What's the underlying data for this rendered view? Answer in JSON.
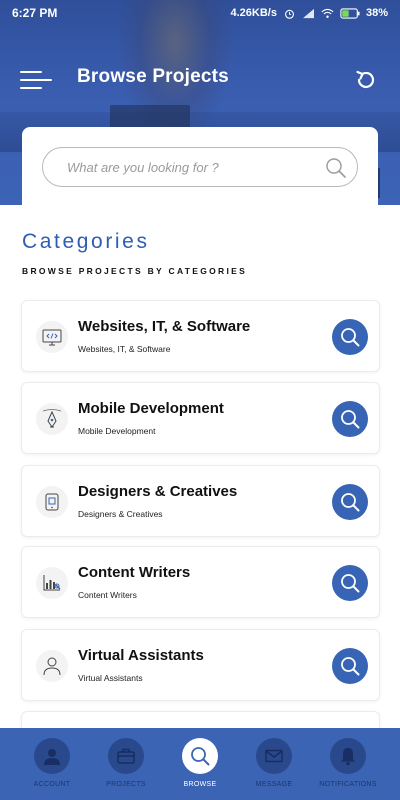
{
  "status_bar": {
    "time": "6:27 PM",
    "network_speed": "4.26KB/s",
    "battery": "38%"
  },
  "header": {
    "title": "Browse Projects"
  },
  "search": {
    "placeholder": "What are you looking for ?"
  },
  "section": {
    "title": "Categories",
    "subtitle": "BROWSE PROJECTS BY CATEGORIES"
  },
  "categories": [
    {
      "title": "Websites, IT, & Software",
      "subtitle": "Websites, IT, & Software",
      "icon": "code-monitor-icon"
    },
    {
      "title": "Mobile Development",
      "subtitle": "Mobile Development",
      "icon": "pen-tool-icon"
    },
    {
      "title": "Designers & Creatives",
      "subtitle": "Designers & Creatives",
      "icon": "device-design-icon"
    },
    {
      "title": "Content Writers",
      "subtitle": "Content Writers",
      "icon": "chart-writing-icon"
    },
    {
      "title": "Virtual Assistants",
      "subtitle": "Virtual Assistants",
      "icon": "person-icon"
    }
  ],
  "bottom_nav": [
    {
      "label": "ACCOUNT",
      "icon": "account-icon",
      "active": false
    },
    {
      "label": "PROJECTS",
      "icon": "briefcase-icon",
      "active": false
    },
    {
      "label": "BROWSE",
      "icon": "search-icon",
      "active": true
    },
    {
      "label": "MESSAGE",
      "icon": "mail-icon",
      "active": false
    },
    {
      "label": "NOTIFICATIONS",
      "icon": "bell-icon",
      "active": false
    }
  ],
  "colors": {
    "primary": "#3b64b5",
    "title_blue": "#2f5db4",
    "nav_bg": "#3b64b5"
  }
}
